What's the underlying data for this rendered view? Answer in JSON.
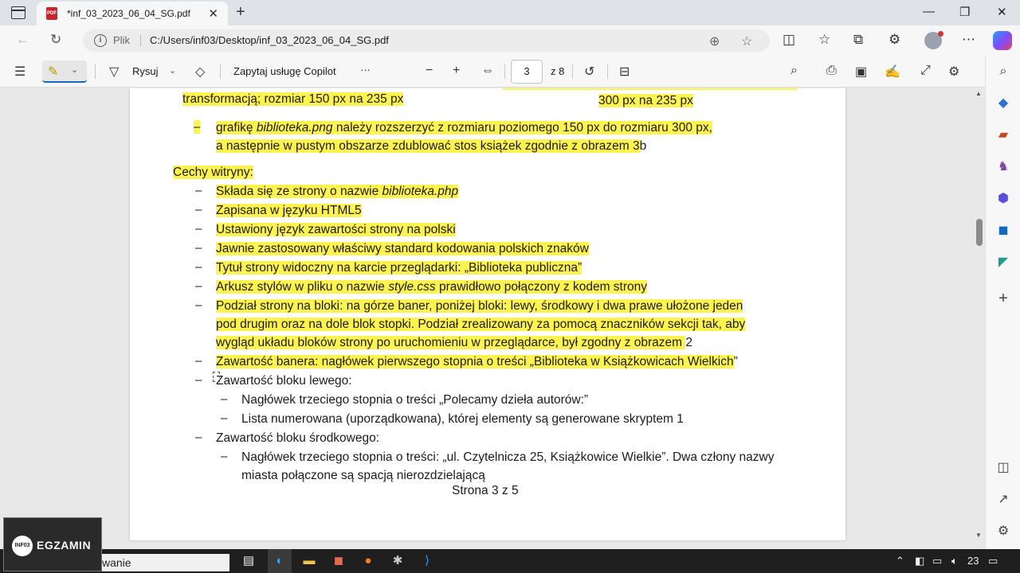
{
  "browser": {
    "tab_title": "*inf_03_2023_06_04_SG.pdf",
    "pdf_badge": "PDF",
    "address_label": "Plik",
    "address_url": "C:/Users/inf03/Desktop/inf_03_2023_06_04_SG.pdf"
  },
  "pdf_toolbar": {
    "draw_label": "Rysuj",
    "copilot_label": "Zapytaj usługę Copilot",
    "more": "···",
    "current_page": "3",
    "page_total": "z 8"
  },
  "document": {
    "top_left": "transformacją; rozmiar 150 px na 235 px",
    "top_right": "300 px na 235 px",
    "bullet0_line1_a": "grafikę ",
    "bullet0_line1_em": "biblioteka.png",
    "bullet0_line1_b": " należy rozszerzyć z rozmiaru poziomego 150 px do rozmiaru 300 px,",
    "bullet0_line2_hl": "a następnie w pustym obszarze zdublować stos książek zgodnie z obrazem 3",
    "bullet0_line2_tail": "b",
    "heading": "Cechy witryny:",
    "dash": "–",
    "item1_a": "Składa się ze strony o nazwie ",
    "item1_em": "biblioteka.php",
    "item2": "Zapisana w języku HTML5",
    "item3": "Ustawiony język zawartości strony na polski",
    "item4": "Jawnie zastosowany właściwy standard kodowania polskich znaków",
    "item5": "Tytuł strony widoczny na karcie przeglądarki: „Biblioteka publiczna”",
    "item6_a": "Arkusz stylów w pliku o nazwie ",
    "item6_em": "style.css",
    "item6_b": " prawidłowo połączony z kodem strony",
    "item7_l1": "Podział strony na bloki: na górze baner, poniżej bloki: lewy, środkowy i dwa prawe ułożone jeden",
    "item7_l2": "pod drugim oraz na dole blok stopki. Podział zrealizowany za pomocą znaczników sekcji tak, aby",
    "item7_l3_hl": "wygląd układu bloków strony po uruchomieniu w przeglądarce, był zgodny z obrazem ",
    "item7_l3_tail": "2",
    "item8_hl": "Zawartość banera: nagłówek pierwszego stopnia o treści „Biblioteka w Książkowicach Wielkich",
    "item8_tail": "”",
    "item9": "Zawartość bloku lewego:",
    "item9_sub1": "Nagłówek trzeciego stopnia o treści „Polecamy dzieła autorów:”",
    "item9_sub2": "Lista numerowana (uporządkowana), której elementy są generowane skryptem 1",
    "item10": "Zawartość bloku środkowego:",
    "item10_sub1_l1": "Nagłówek trzeciego stopnia o treści: „ul. Czytelnicza 25, Książkowice Wielkie”. Dwa człony nazwy",
    "item10_sub1_l2": "miasta połączone są spacją nierozdzielającą",
    "footer": "Strona 3 z 5"
  },
  "taskbar": {
    "search_text": "wanie",
    "clock": "23"
  },
  "overlay": {
    "egzamin": "EGZAMIN",
    "logo": "INF03"
  },
  "colors": {
    "highlight": "#fff44f",
    "accent": "#0f6cbd"
  }
}
